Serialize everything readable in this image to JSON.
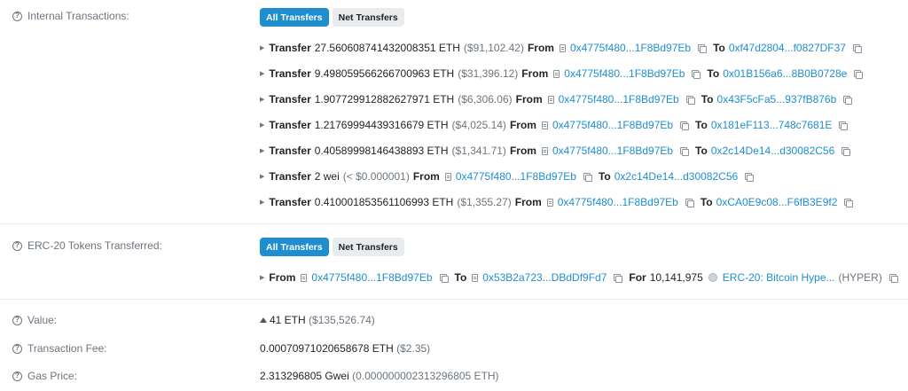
{
  "internal": {
    "label": "Internal Transactions:",
    "tabs": [
      "All Transfers",
      "Net Transfers"
    ],
    "rows": [
      {
        "prefix": "Transfer",
        "amount": "27.560608741432008351 ETH",
        "usd": "($91,102.42)",
        "from_label": "From",
        "from": "0x4775f480...1F8Bd97Eb",
        "to_label": "To",
        "to": "0xf47d2804...f0827DF37"
      },
      {
        "prefix": "Transfer",
        "amount": "9.498059566266700963 ETH",
        "usd": "($31,396.12)",
        "from_label": "From",
        "from": "0x4775f480...1F8Bd97Eb",
        "to_label": "To",
        "to": "0x01B156a6...8B0B0728e"
      },
      {
        "prefix": "Transfer",
        "amount": "1.907729912882627971 ETH",
        "usd": "($6,306.06)",
        "from_label": "From",
        "from": "0x4775f480...1F8Bd97Eb",
        "to_label": "To",
        "to": "0x43F5cFa5...937fB876b"
      },
      {
        "prefix": "Transfer",
        "amount": "1.21769994439316679 ETH",
        "usd": "($4,025.14)",
        "from_label": "From",
        "from": "0x4775f480...1F8Bd97Eb",
        "to_label": "To",
        "to": "0x181eF113...748c7681E"
      },
      {
        "prefix": "Transfer",
        "amount": "0.40589998146438893 ETH",
        "usd": "($1,341.71)",
        "from_label": "From",
        "from": "0x4775f480...1F8Bd97Eb",
        "to_label": "To",
        "to": "0x2c14De14...d30082C56"
      },
      {
        "prefix": "Transfer",
        "amount": "2 wei",
        "usd": "(< $0.000001)",
        "from_label": "From",
        "from": "0x4775f480...1F8Bd97Eb",
        "to_label": "To",
        "to": "0x2c14De14...d30082C56"
      },
      {
        "prefix": "Transfer",
        "amount": "0.410001853561106993 ETH",
        "usd": "($1,355.27)",
        "from_label": "From",
        "from": "0x4775f480...1F8Bd97Eb",
        "to_label": "To",
        "to": "0xCA0E9c08...F6fB3E9f2"
      }
    ]
  },
  "erc20": {
    "label": "ERC-20 Tokens Transferred:",
    "tabs": [
      "All Transfers",
      "Net Transfers"
    ],
    "row": {
      "from_label": "From",
      "from": "0x4775f480...1F8Bd97Eb",
      "to_label": "To",
      "to": "0x53B2a723...DBdDf9Fd7",
      "for_label": "For",
      "amount": "10,141,975",
      "token": "ERC-20: Bitcoin Hype...",
      "symbol": "(HYPER)"
    }
  },
  "value": {
    "label": "Value:",
    "amount": "41 ETH",
    "usd": "($135,526.74)"
  },
  "fee": {
    "label": "Transaction Fee:",
    "amount": "0.00070971020658678 ETH",
    "usd": "($2.35)"
  },
  "gas": {
    "label": "Gas Price:",
    "amount": "2.313296805 Gwei",
    "eth": "(0.000000002313296805 ETH)"
  },
  "colors": {
    "accent": "#1e8ecf",
    "muted": "#6c757d"
  }
}
